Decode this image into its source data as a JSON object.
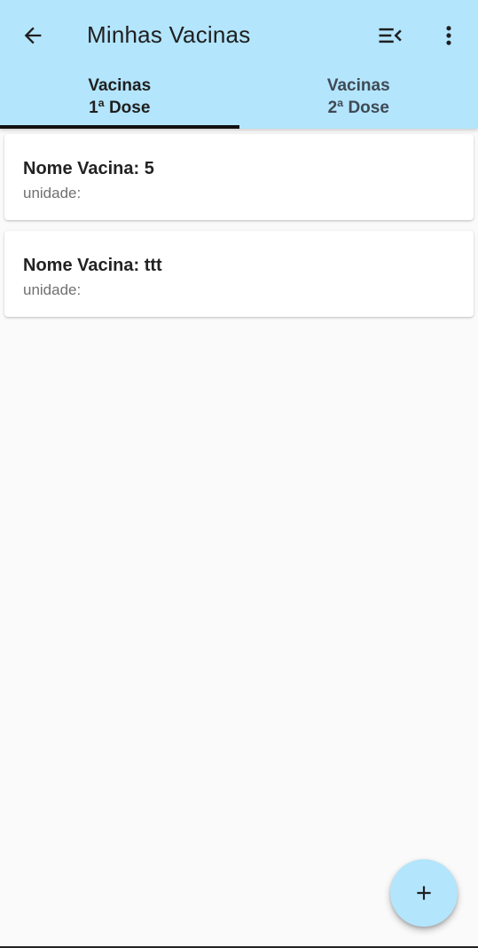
{
  "appbar": {
    "title": "Minhas Vacinas",
    "background": "#b3e5fc",
    "back_icon": "arrow-left-icon",
    "sort_icon": "sort-collapse-icon",
    "more_icon": "more-vertical-icon"
  },
  "tabs": [
    {
      "line1": "Vacinas",
      "line2": "1ª Dose",
      "active": true
    },
    {
      "line1": "Vacinas",
      "line2": "2ª Dose",
      "active": false
    }
  ],
  "vaccines": [
    {
      "name": "Nome Vacina: 5",
      "unit": "unidade:"
    },
    {
      "name": "Nome Vacina: ttt",
      "unit": "unidade:"
    }
  ],
  "fab": {
    "icon": "plus-icon"
  }
}
